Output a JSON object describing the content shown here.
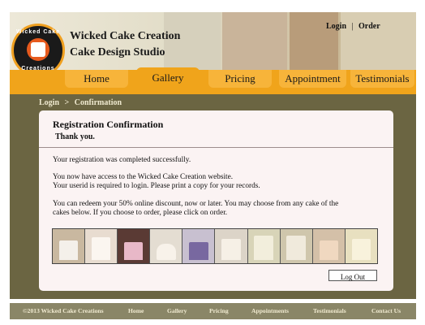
{
  "brand": {
    "logo_top_text": "Wicked Cake",
    "logo_bottom_text": "Creations",
    "line1": "Wicked Cake Creation",
    "line2": "Cake Design Studio"
  },
  "top_links": {
    "login": "Login",
    "separator": "|",
    "order": "Order"
  },
  "nav": {
    "tabs": [
      {
        "label": "Home"
      },
      {
        "label": "Gallery"
      },
      {
        "label": "Pricing"
      },
      {
        "label": "Appointment"
      },
      {
        "label": "Testimonials"
      }
    ],
    "selected": "Gallery"
  },
  "breadcrumb": {
    "first": "Login",
    "separator": ">",
    "current": "Confirmation"
  },
  "panel": {
    "title": "Registration Confirmation",
    "thanks": "Thank you.",
    "lines": [
      "Your registration was completed successfully.",
      "You now have access to  the Wicked Cake Creation website.",
      "Your userid is required to login. Please print a copy for your records.",
      "You can redeem your 50%  online discount,  now or later.  You may choose from any cake of the",
      "cakes below.  If you choose to order, please click on order."
    ],
    "logout_label": "Log Out"
  },
  "gallery_thumbs": [
    {
      "icon": "tiered-cake-icon",
      "color": "#c9b8a0"
    },
    {
      "icon": "tiered-cake-icon",
      "color": "#e8dcd0"
    },
    {
      "icon": "flower-cake-icon",
      "color": "#d8c8c0"
    },
    {
      "icon": "teapot-cake-icon",
      "color": "#e4ddd2"
    },
    {
      "icon": "flower-cake-icon",
      "color": "#c8c0d0"
    },
    {
      "icon": "tiered-cake-icon",
      "color": "#dcd4c8"
    },
    {
      "icon": "tiered-cake-icon",
      "color": "#d8d4b8"
    },
    {
      "icon": "tiered-cake-icon",
      "color": "#cfc6ac"
    },
    {
      "icon": "flower-cake-icon",
      "color": "#d4c0a8"
    },
    {
      "icon": "tiered-cake-icon",
      "color": "#e8e0c0"
    }
  ],
  "footer": {
    "copyright": "©2013 Wicked Cake Creations",
    "links": [
      "Home",
      "Gallery",
      "Pricing",
      "Appointments",
      "Testimonials",
      "Contact Us"
    ]
  },
  "colors": {
    "nav_orange": "#f0a41b",
    "olive_background": "#6b6542",
    "panel": "#fbf3f3",
    "footer": "#8a8667"
  }
}
